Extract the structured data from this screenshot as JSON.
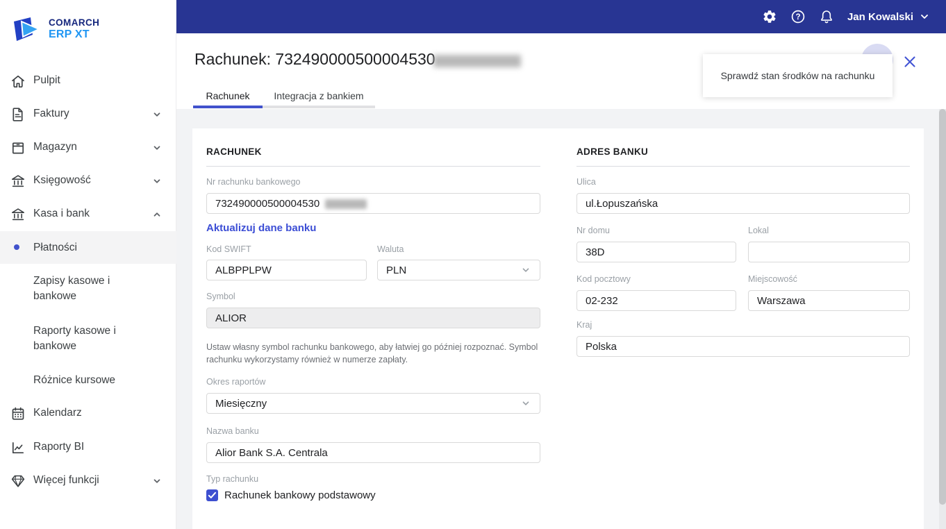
{
  "brand": {
    "name_top": "COMARCH",
    "name_bottom": "ERP XT"
  },
  "topbar": {
    "user_name": "Jan Kowalski",
    "icons": [
      "settings",
      "help",
      "notifications"
    ]
  },
  "sidebar": {
    "items": [
      {
        "icon": "home",
        "label": "Pulpit"
      },
      {
        "icon": "invoice",
        "label": "Faktury",
        "expandable": true
      },
      {
        "icon": "box",
        "label": "Magazyn",
        "expandable": true
      },
      {
        "icon": "bank",
        "label": "Księgowość",
        "expandable": true
      },
      {
        "icon": "bank",
        "label": "Kasa i bank",
        "expandable": true,
        "expanded": true
      },
      {
        "icon": "calendar",
        "label": "Kalendarz"
      },
      {
        "icon": "chart",
        "label": "Raporty BI"
      },
      {
        "icon": "diamond",
        "label": "Więcej funkcji",
        "expandable": true
      }
    ],
    "kasa_sub": [
      {
        "label": "Płatności",
        "active": true
      },
      {
        "label": "Zapisy kasowe i bankowe"
      },
      {
        "label": "Raporty kasowe i bankowe"
      },
      {
        "label": "Różnice kursowe"
      }
    ]
  },
  "header": {
    "title": "Rachunek: 732490000500004530",
    "title_suffix_redacted": true,
    "tabs": [
      {
        "label": "Rachunek",
        "active": true
      },
      {
        "label": "Integracja z bankiem",
        "active": false
      }
    ]
  },
  "notice": {
    "text": "Sprawdź stan środków na rachunku"
  },
  "form": {
    "rachunek": {
      "heading": "RACHUNEK",
      "nr_label": "Nr rachunku bankowego",
      "nr_value": "732490000500004530",
      "nr_suffix_redacted": true,
      "update_link": "Aktualizuj dane banku",
      "swift_label": "Kod SWIFT",
      "swift_value": "ALBPPLPW",
      "waluta_label": "Waluta",
      "waluta_value": "PLN",
      "symbol_label": "Symbol",
      "symbol_value": "ALIOR",
      "symbol_help": "Ustaw własny symbol rachunku bankowego, aby łatwiej go później rozpoznać. Symbol rachunku wykorzystamy również w numerze zapłaty.",
      "okres_label": "Okres raportów",
      "okres_value": "Miesięczny",
      "nazwa_label": "Nazwa banku",
      "nazwa_value": "Alior Bank S.A. Centrala",
      "typ_label": "Typ rachunku",
      "typ_checkbox_label": "Rachunek bankowy podstawowy",
      "typ_checkbox_checked": true
    },
    "adres": {
      "heading": "ADRES BANKU",
      "ulica_label": "Ulica",
      "ulica_value": "ul.Łopuszańska",
      "nr_domu_label": "Nr domu",
      "nr_domu_value": "38D",
      "lokal_label": "Lokal",
      "lokal_value": "",
      "kod_label": "Kod pocztowy",
      "kod_value": "02-232",
      "miejscowosc_label": "Miejscowość",
      "miejscowosc_value": "Warszawa",
      "kraj_label": "Kraj",
      "kraj_value": "Polska"
    }
  },
  "colors": {
    "topbar": "#283593",
    "accent": "#4152cc",
    "link": "#3c4ed5",
    "content_bg": "#f2f3f5"
  }
}
